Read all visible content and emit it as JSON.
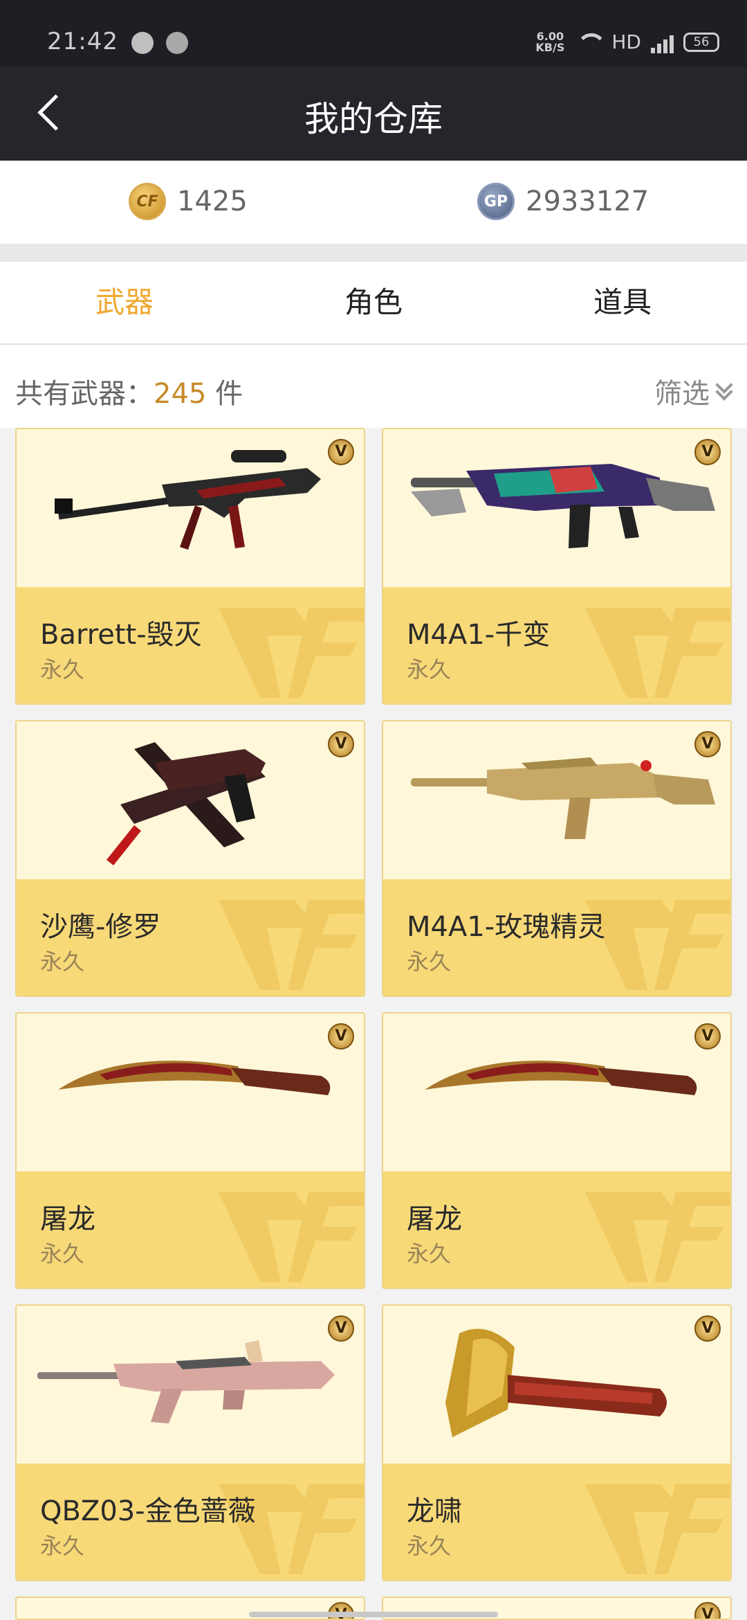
{
  "status": {
    "time": "21:42",
    "speed_top": "6.00",
    "speed_bottom": "KB/S",
    "network": "HD",
    "battery": "56"
  },
  "nav": {
    "title": "我的仓库"
  },
  "currency": {
    "cf_value": "1425",
    "cf_icon": "cf-coin-icon",
    "gp_value": "2933127",
    "gp_label": "GP"
  },
  "tabs": [
    {
      "label": "武器"
    },
    {
      "label": "角色"
    },
    {
      "label": "道具"
    }
  ],
  "info": {
    "count_prefix": "共有武器：",
    "count_value": "245",
    "count_suffix": " 件",
    "filter_label": "筛选"
  },
  "items": [
    {
      "name": "Barrett-毁灭",
      "duration": "永久",
      "badge": "V"
    },
    {
      "name": "M4A1-千变",
      "duration": "永久",
      "badge": "V"
    },
    {
      "name": "沙鹰-修罗",
      "duration": "永久",
      "badge": "V"
    },
    {
      "name": "M4A1-玫瑰精灵",
      "duration": "永久",
      "badge": "V"
    },
    {
      "name": "屠龙",
      "duration": "永久",
      "badge": "V"
    },
    {
      "name": "屠龙",
      "duration": "永久",
      "badge": "V"
    },
    {
      "name": "QBZ03-金色蔷薇",
      "duration": "永久",
      "badge": "V"
    },
    {
      "name": "龙啸",
      "duration": "永久",
      "badge": "V"
    }
  ],
  "colors": {
    "accent": "#f0a830",
    "card_bg": "#fff7d9",
    "card_footer": "#f8d978",
    "nav_bg": "#25262b"
  }
}
